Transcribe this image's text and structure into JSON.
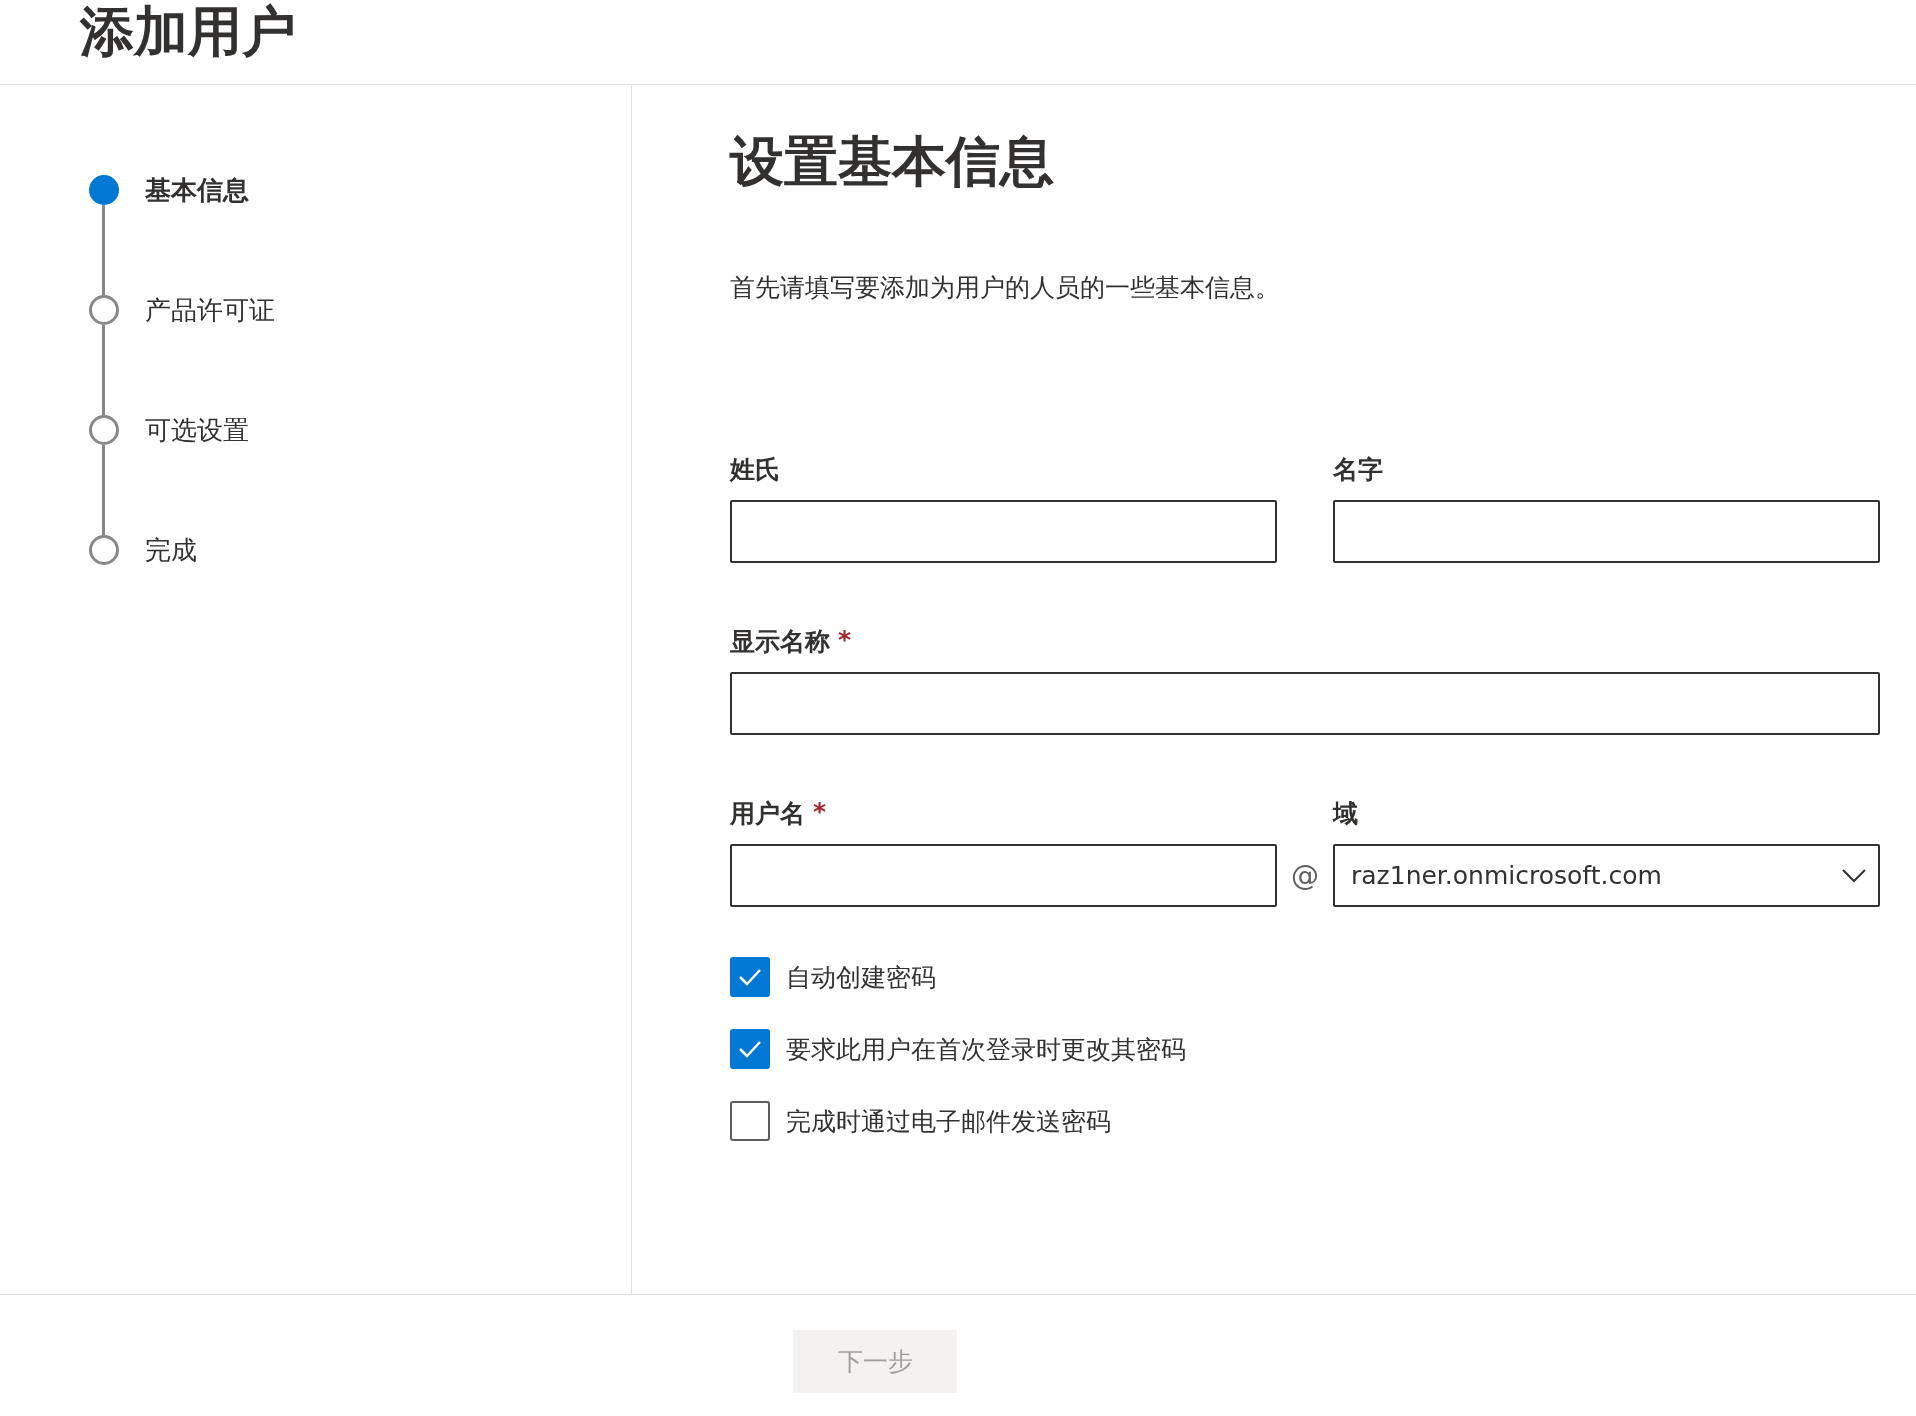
{
  "header": {
    "title": "添加用户"
  },
  "steps": [
    {
      "label": "基本信息",
      "selected": true
    },
    {
      "label": "产品许可证",
      "selected": false
    },
    {
      "label": "可选设置",
      "selected": false
    },
    {
      "label": "完成",
      "selected": false
    }
  ],
  "main": {
    "title": "设置基本信息",
    "description": "首先请填写要添加为用户的人员的一些基本信息。",
    "last_name": {
      "label": "姓氏"
    },
    "first_name": {
      "label": "名字"
    },
    "display_name": {
      "label": "显示名称",
      "required_mark": "*"
    },
    "username": {
      "label": "用户名",
      "required_mark": "*"
    },
    "separator": "@",
    "domain": {
      "label": "域",
      "value": "raz1ner.onmicrosoft.com"
    },
    "checkboxes": [
      {
        "label": "自动创建密码",
        "checked": true
      },
      {
        "label": "要求此用户在首次登录时更改其密码",
        "checked": true
      },
      {
        "label": "完成时通过电子邮件发送密码",
        "checked": false
      }
    ]
  },
  "footer": {
    "next_button": {
      "label": "下一步",
      "disabled": true
    }
  }
}
